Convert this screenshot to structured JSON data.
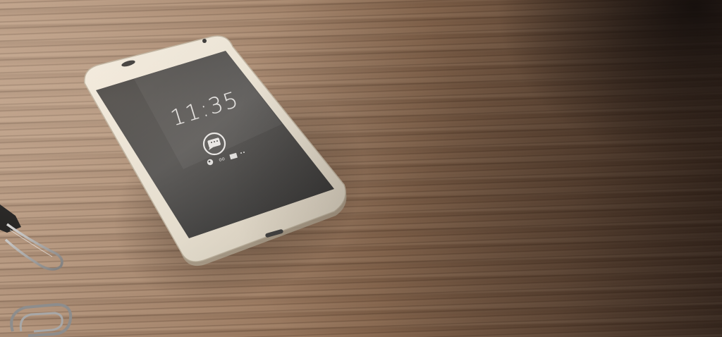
{
  "scene": {
    "subject": "smartphone-on-wooden-desk",
    "phone": {
      "body_color": "#e8e1d3",
      "screen_color": "#3a3a3a",
      "lock_screen": {
        "time": "11:35",
        "notification_icon": "message-icon"
      }
    },
    "objects": [
      "binder-clip",
      "paper-clip"
    ]
  }
}
